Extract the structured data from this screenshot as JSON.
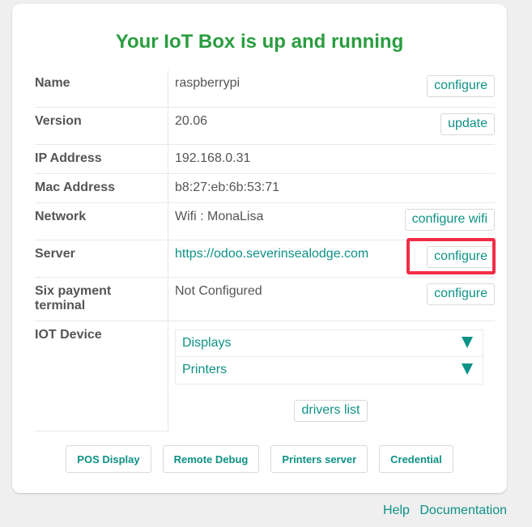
{
  "title": "Your IoT Box is up and running",
  "rows": [
    {
      "label": "Name",
      "value": "raspberrypi",
      "button": "configure"
    },
    {
      "label": "Version",
      "value": "20.06",
      "button": "update"
    },
    {
      "label": "IP Address",
      "value": "192.168.0.31"
    },
    {
      "label": "Mac Address",
      "value": "b8:27:eb:6b:53:71"
    },
    {
      "label": "Network",
      "value": "Wifi : MonaLisa",
      "button": "configure wifi"
    },
    {
      "label": "Server",
      "value": "https://odoo.severinsealodge.com",
      "button": "configure",
      "highlighted": true
    },
    {
      "label": "Six payment terminal",
      "value": "Not Configured",
      "button": "configure"
    },
    {
      "label": "IOT Device"
    }
  ],
  "iot_devices": [
    {
      "label": "Displays",
      "icon": "triangle-down-icon"
    },
    {
      "label": "Printers",
      "icon": "triangle-down-icon"
    }
  ],
  "drivers_button": "drivers list",
  "bottom_buttons": [
    "POS Display",
    "Remote Debug",
    "Printers server",
    "Credential"
  ],
  "footer": {
    "help": "Help",
    "documentation": "Documentation"
  },
  "colors": {
    "title": "#2a9d3f",
    "accent": "#0e9186",
    "highlight": "#f22d47",
    "background": "#efefef"
  }
}
